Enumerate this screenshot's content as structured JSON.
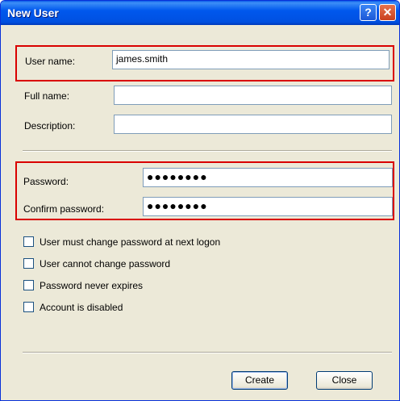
{
  "window": {
    "title": "New User",
    "help_label": "?",
    "close_label": "✕"
  },
  "form": {
    "user_name": {
      "label": "User name:",
      "value": "james.smith"
    },
    "full_name": {
      "label": "Full name:",
      "value": ""
    },
    "description": {
      "label": "Description:",
      "value": ""
    },
    "password": {
      "label": "Password:",
      "value": "●●●●●●●●"
    },
    "confirm_password": {
      "label": "Confirm password:",
      "value": "●●●●●●●●"
    }
  },
  "options": [
    {
      "label": "User must change password at next logon",
      "checked": false
    },
    {
      "label": "User cannot change password",
      "checked": false
    },
    {
      "label": "Password never expires",
      "checked": false
    },
    {
      "label": "Account is disabled",
      "checked": false
    }
  ],
  "buttons": {
    "create": "Create",
    "close": "Close"
  },
  "colors": {
    "highlight": "#d90000",
    "title_bar": "#0058ee"
  }
}
